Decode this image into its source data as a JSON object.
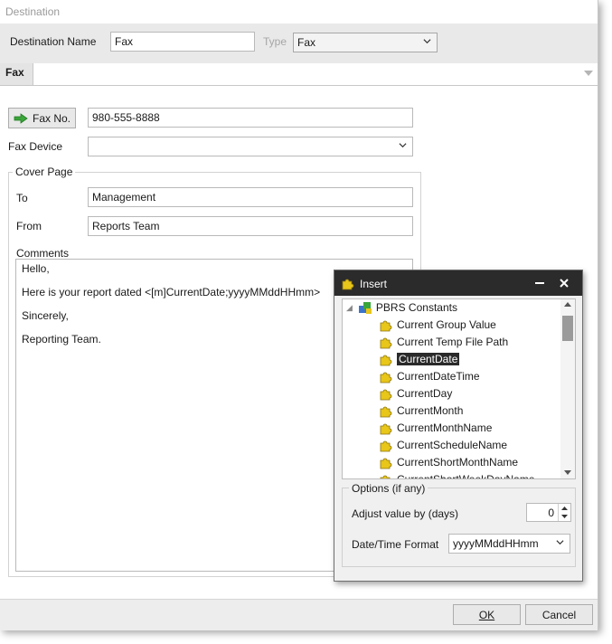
{
  "window": {
    "title": "Destination"
  },
  "destination": {
    "name_label": "Destination Name",
    "name_value": "Fax",
    "type_label": "Type",
    "type_value": "Fax"
  },
  "tabs": [
    {
      "label": "Fax"
    }
  ],
  "fax": {
    "fax_no_button": "Fax No.",
    "fax_no_value": "980-555-8888",
    "device_label": "Fax Device",
    "device_value": ""
  },
  "cover_page": {
    "legend": "Cover Page",
    "to_label": "To",
    "to_value": "Management",
    "from_label": "From",
    "from_value": "Reports Team",
    "comments_label": "Comments",
    "comments_lines": [
      "Hello,",
      "Here is your report dated <[m]CurrentDate;yyyyMMddHHmm>",
      "Sincerely,",
      "Reporting Team."
    ]
  },
  "footer": {
    "ok_label": "OK",
    "cancel_label": "Cancel"
  },
  "insert_dialog": {
    "title": "Insert",
    "tree_root": "PBRS Constants",
    "items": [
      "Current Group Value",
      "Current Temp File Path",
      "CurrentDate",
      "CurrentDateTime",
      "CurrentDay",
      "CurrentMonth",
      "CurrentMonthName",
      "CurrentScheduleName",
      "CurrentShortMonthName",
      "CurrentShortWeekDayName"
    ],
    "selected_item": "CurrentDate",
    "options_legend": "Options (if any)",
    "adjust_label": "Adjust value by (days)",
    "adjust_value": "0",
    "format_label": "Date/Time Format",
    "format_value": "yyyyMMddHHmm"
  },
  "colors": {
    "selected_bg": "#2a2a2a",
    "dialog_title_bg": "#2b2b2b",
    "arrow_green": "#3aa53a",
    "puzzle_yellow": "#e8c61a"
  }
}
